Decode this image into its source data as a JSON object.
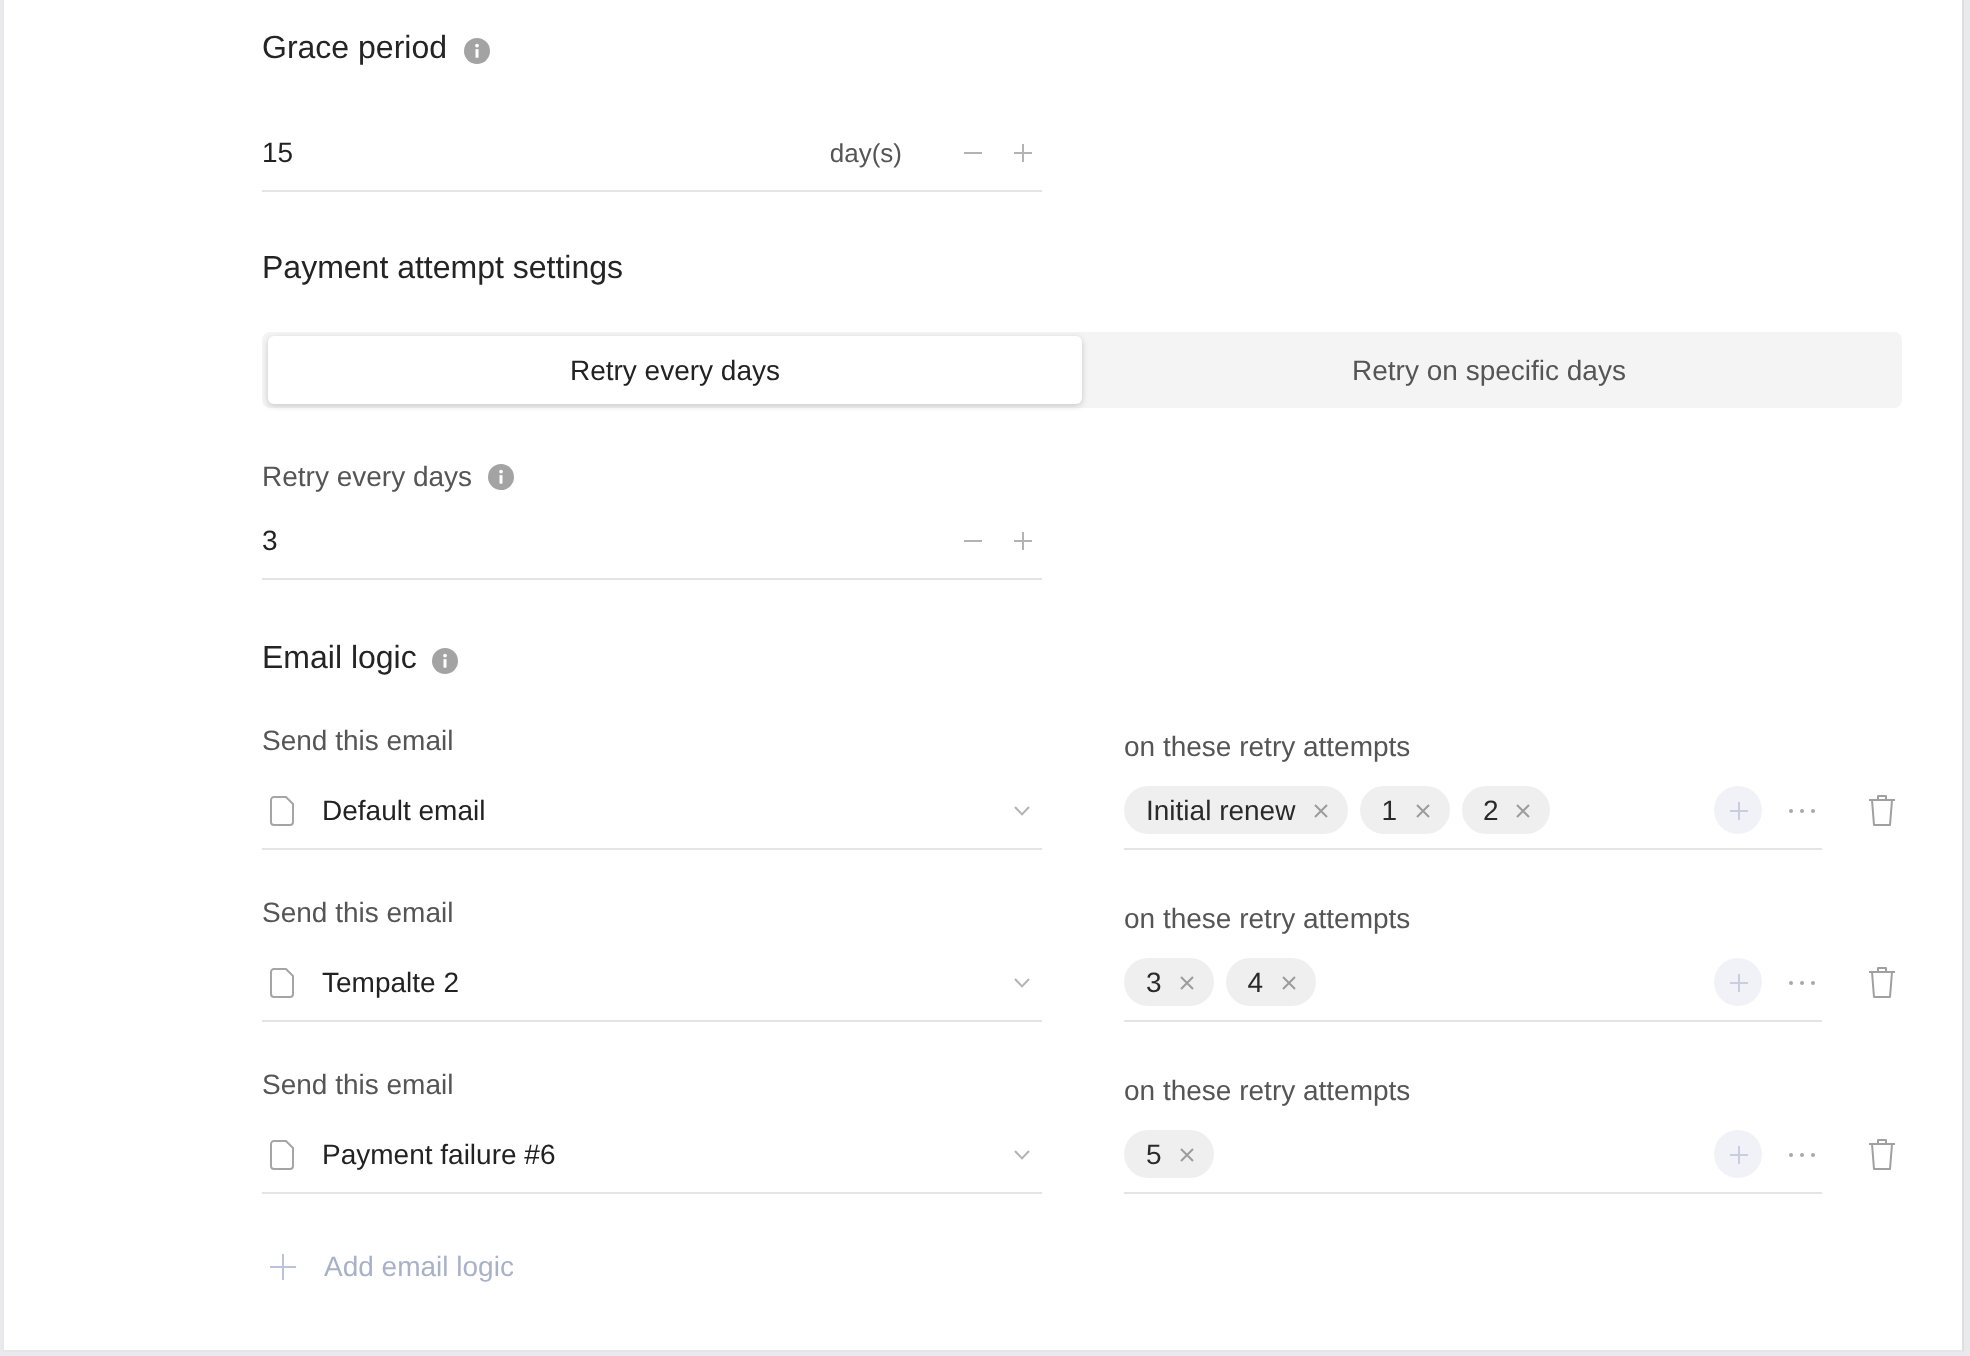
{
  "grace_period": {
    "title": "Grace period",
    "info": true,
    "field": {
      "value": "15",
      "unit": "day(s)"
    }
  },
  "payment_attempt_settings": {
    "title": "Payment attempt settings",
    "info": false,
    "tabs": [
      {
        "label": "Retry every days",
        "selected": true
      },
      {
        "label": "Retry on specific days",
        "selected": false
      }
    ],
    "retry_field": {
      "label": "Retry every days",
      "info": true,
      "value": "3"
    }
  },
  "email_logic": {
    "title": "Email logic",
    "info": true,
    "rules": [
      {
        "email_label": "Send this email",
        "email": "Default email",
        "attempts_label": "on these retry attempts",
        "attempts": [
          "Initial renew",
          "1",
          "2"
        ]
      },
      {
        "email_label": "Send this email",
        "email": "Tempalte 2",
        "attempts_label": "on these retry attempts",
        "attempts": [
          "3",
          "4"
        ]
      },
      {
        "email_label": "Send this email",
        "email": "Payment failure #6",
        "attempts_label": "on these retry attempts",
        "attempts": [
          "5"
        ]
      }
    ],
    "add_label": "Add email logic"
  }
}
